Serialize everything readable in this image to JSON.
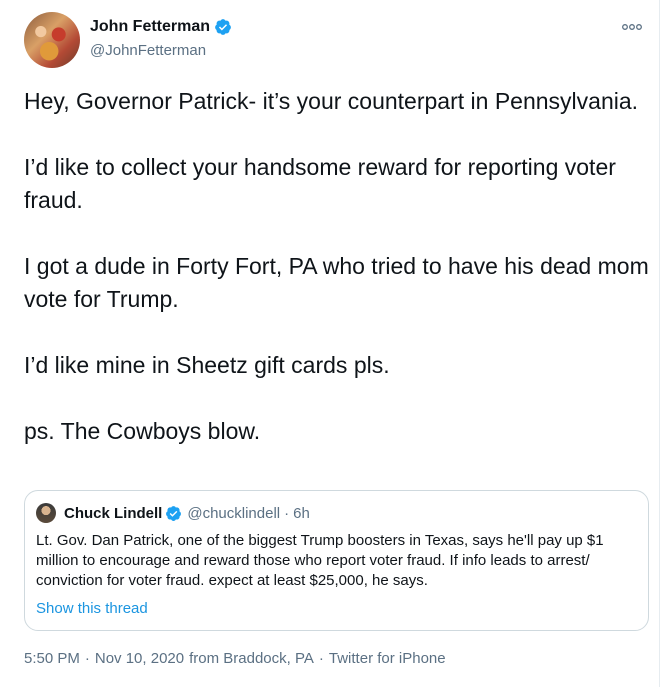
{
  "author": {
    "display_name": "John Fetterman",
    "handle": "@JohnFetterman",
    "verified": true
  },
  "tweet": {
    "paragraphs": [
      "Hey, Governor Patrick- it’s your counterpart in Pennsylvania.",
      "I’d like to collect your handsome reward for reporting voter fraud.",
      "I got a dude in Forty Fort, PA who tried to have his dead mom vote for Trump.",
      "I’d like mine in Sheetz gift cards pls.",
      "ps.  The Cowboys blow."
    ]
  },
  "quoted_tweet": {
    "display_name": "Chuck Lindell",
    "handle": "@chucklindell",
    "separator": "·",
    "time": "6h",
    "verified": true,
    "text": "Lt. Gov. Dan Patrick, one of the biggest Trump boosters in Texas, says he'll pay up $1 million to encourage and reward those who report voter fraud. If info leads to arrest/ conviction for voter fraud. expect at least $25,000, he says.",
    "show_thread_label": "Show this thread"
  },
  "meta": {
    "time": "5:50 PM",
    "date": "Nov 10, 2020",
    "location": "from Braddock, PA",
    "source": "Twitter for iPhone",
    "separator": "·"
  },
  "colors": {
    "accent": "#1da1f2",
    "link": "#1b95e0",
    "secondary_text": "#5b7083",
    "border": "#cfd9de"
  },
  "icons": {
    "verified": "verified-badge-icon",
    "more": "more-options-icon"
  }
}
